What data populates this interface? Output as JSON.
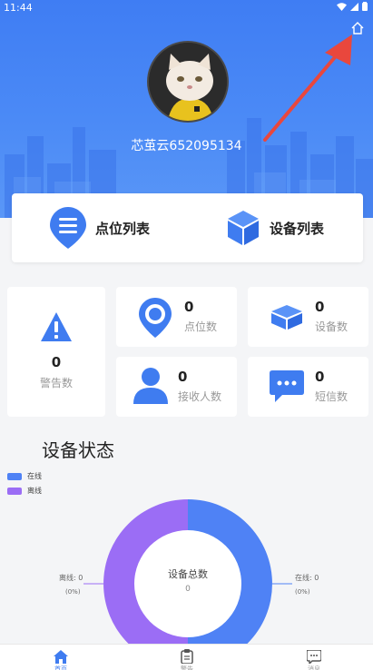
{
  "status_bar": {
    "time": "11:44"
  },
  "profile": {
    "username": "芯茧云652095134"
  },
  "nav": {
    "points_label": "点位列表",
    "devices_label": "设备列表"
  },
  "stats": {
    "alerts": {
      "value": "0",
      "label": "警告数"
    },
    "points": {
      "value": "0",
      "label": "点位数"
    },
    "devices": {
      "value": "0",
      "label": "设备数"
    },
    "receivers": {
      "value": "0",
      "label": "接收人数"
    },
    "sms": {
      "value": "0",
      "label": "短信数"
    }
  },
  "device_status": {
    "title": "设备状态",
    "legend": [
      {
        "label": "在线",
        "color": "#4f82f5"
      },
      {
        "label": "离线",
        "color": "#9b6df5"
      }
    ]
  },
  "chart_data": {
    "type": "pie",
    "center_title": "设备总数",
    "center_value": "0",
    "slices": [
      {
        "label": "在线",
        "value": 0,
        "percent": "0%",
        "callout": "在线: 0",
        "callout_pct": "(0%)"
      },
      {
        "label": "离线",
        "value": 0,
        "percent": "0%",
        "callout": "离线: 0",
        "callout_pct": "(0%)"
      }
    ]
  },
  "tabs": [
    {
      "label": "首页"
    },
    {
      "label": "警告"
    },
    {
      "label": "消息"
    }
  ],
  "colors": {
    "primary": "#4b8af6",
    "online": "#4f82f5",
    "offline": "#9b6df5"
  }
}
